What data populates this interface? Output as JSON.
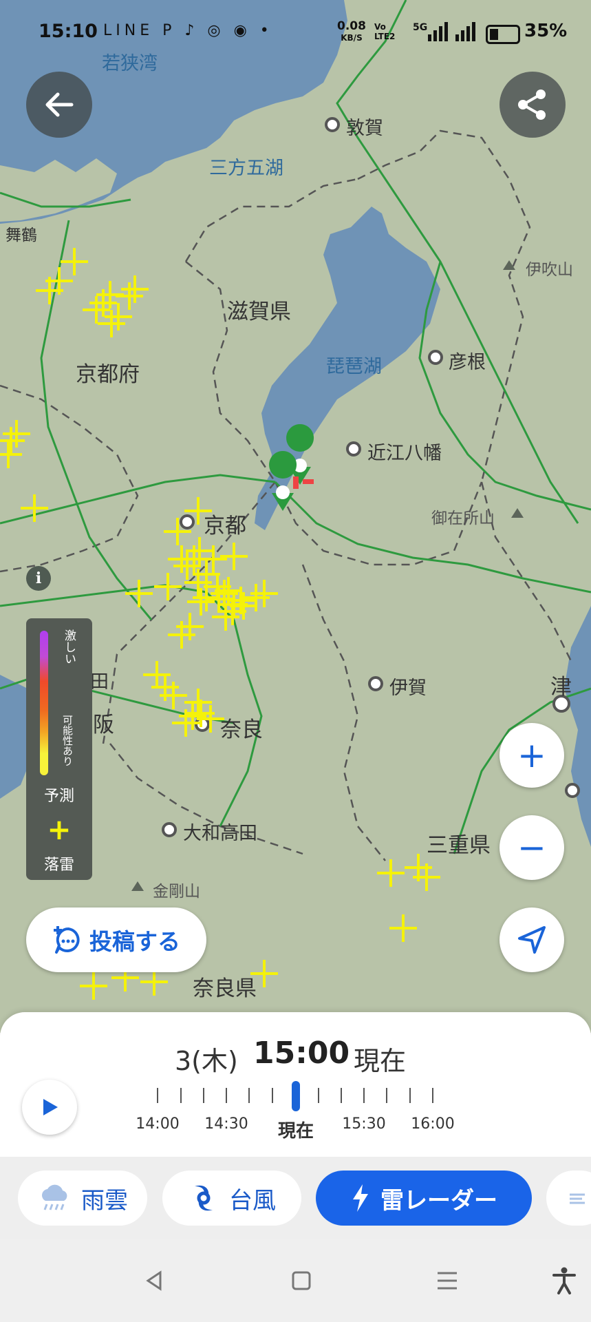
{
  "status_bar": {
    "time": "15:10",
    "app_icons": "LINE P ♪ ◎ ◉ •",
    "net_speed": "0.08",
    "net_unit": "KB/S",
    "volte": "Vo LTE2",
    "signal": "5G",
    "battery": "35%"
  },
  "map": {
    "labels": {
      "wakasa_bay": "若狭湾",
      "tsuruga": "敦賀",
      "mikata": "三方五湖",
      "maizuru": "舞鶴",
      "ibukiyama": "伊吹山",
      "shiga": "滋賀県",
      "kyoto_pref": "京都府",
      "biwako": "琵琶湖",
      "hikone": "彦根",
      "omihachiman": "近江八幡",
      "gozaisho": "御在所山",
      "kyoto": "京都",
      "suita": "吹田",
      "osaka": "大阪",
      "iga": "伊賀",
      "tsu": "津",
      "nara": "奈良",
      "yamatotakada": "大和高田",
      "mie": "三重県",
      "kongosan": "金剛山",
      "nara_pref": "奈良県"
    },
    "legend": {
      "intense": "激しい",
      "possible": "可能性あり",
      "forecast": "予測",
      "strike_symbol": "+",
      "strike": "落雷"
    },
    "info_icon": "i",
    "post_button": "投稿する",
    "zoom_in": "+",
    "zoom_out": "−"
  },
  "timeline": {
    "date": "3(木)",
    "time": "15:00",
    "now_label": "現在",
    "ticks": [
      "14:00",
      "14:30",
      "現在",
      "15:30",
      "16:00"
    ]
  },
  "layers": [
    {
      "label": "雨雲",
      "icon": "rain-cloud-icon",
      "active": false
    },
    {
      "label": "台風",
      "icon": "typhoon-icon",
      "active": false
    },
    {
      "label": "雷レーダー",
      "icon": "lightning-icon",
      "active": true
    }
  ],
  "colors": {
    "accent": "#1a64e8",
    "strike": "#f5f20a",
    "water": "#6e93b8",
    "land": "#b9c4a9"
  }
}
